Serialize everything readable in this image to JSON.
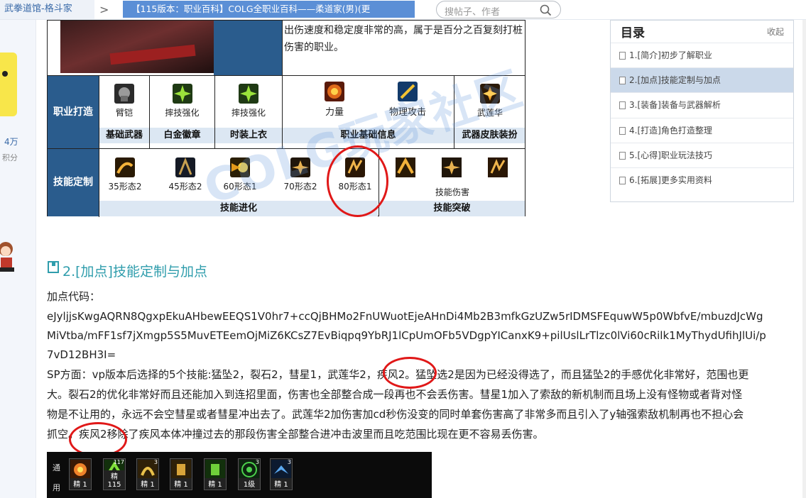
{
  "topbar": {
    "home_crumb": "武拳道馆-格斗家",
    "arrow": ">",
    "thread_crumb": "【115版本：职业百科】COLG全职业百科——柔道家(男)(更",
    "search_placeholder": "搜帖子、作者"
  },
  "leftbar": {
    "stat_value": "4万",
    "stat_label": "积分"
  },
  "profession_table": {
    "description": "出伤速度和稳定度非常的高，属于是百分之百复刻打桩伤害的职业。",
    "row1_label": "职业打造",
    "row2_label": "技能定制",
    "build_items": [
      {
        "label": "臂铠",
        "icon": "gauntlet-icon"
      },
      {
        "label": "摔技强化",
        "icon": "throw-burst-icon"
      },
      {
        "label": "摔技强化",
        "icon": "throw-burst-icon"
      },
      {
        "label": "力量",
        "icon": "strength-icon"
      },
      {
        "label": "物理攻击",
        "icon": "physical-attack-icon"
      },
      {
        "label": "武莲华",
        "icon": "lotus-skill-icon"
      }
    ],
    "build_groups": [
      "基础武器",
      "白金徽章",
      "时装上衣",
      "职业基础信息",
      "武器皮肤装扮"
    ],
    "skill_items": [
      {
        "label": "35形态2"
      },
      {
        "label": "45形态2"
      },
      {
        "label": "60形态1"
      },
      {
        "label": "70形态2"
      },
      {
        "label": "80形态1"
      },
      {
        "label": "技能伤害"
      }
    ],
    "skill_groups": [
      "技能进化",
      "技能突破"
    ],
    "watermark": "COLG玩家社区"
  },
  "toc": {
    "title": "目录",
    "collapse": "收起",
    "items": [
      "1.[简介]初步了解职业",
      "2.[加点]技能定制与加点",
      "3.[装备]装备与武器解析",
      "4.[打造]角色打造整理",
      "5.[心得]职业玩法技巧",
      "6.[拓展]更多实用资料"
    ],
    "active_index": 1
  },
  "section": {
    "title": "2.[加点]技能定制与加点",
    "code_label": "加点代码：",
    "code_lines": [
      "eJyljjsKwgAQRN8QgxpEkuAHbewEEQS1V0hr7+ccQjBHMo2FnUWuotEjeAHnDi4Mb2B3mfkGzUZw5rIDMSFEquwW5p0WbfvE/mbuzdJcWg",
      "MiVtba/mFF1sf7jXmgp5S5MuvETEemOjMiZ6KCsZ7EvBiqpq9YbRJ1lCpUmOFb5VDgpYICanxK9+pilUslLrTlzc0lVi60cRilk1MyThydUfihJlUi/p",
      "7vD12BH3I="
    ],
    "sp_lines": [
      "SP方面：vp版本后选择的5个技能:猛坠2，裂石2，彗星1，武莲华2，疾风2。猛坠选2是因为已经没得选了，而且猛坠2的手感优化非常好，范围也更",
      "大。裂石2的优化非常好而且还能加入到连招里面，伤害也全部整合成一段再也不会丢伤害。彗星1加入了索敌的新机制而且场上没有怪物或者背对怪",
      "物是不让用的，永远不会空彗星或者彗星冲出去了。武莲华2加伤害加cd秒伤没变的同时单套伤害高了非常多而且引入了y轴强索敌机制再也不担心会",
      "抓空。疾风2移除了疾风本体冲撞过去的那段伤害全部整合进冲击波里而且吃范围比现在更不容易丢伤害。"
    ]
  },
  "skillbar": {
    "label_top": "通",
    "label_bottom": "用",
    "slots": [
      {
        "cap": "精 1",
        "num": "",
        "icon": "fire-fist-icon"
      },
      {
        "cap": "精 115",
        "num": "117",
        "icon": "green-throw-icon"
      },
      {
        "cap": "精 1",
        "num": "3",
        "icon": "gold-throw-icon"
      },
      {
        "cap": "精 1",
        "num": "",
        "icon": "gold-grab-icon"
      },
      {
        "cap": "精 1",
        "num": "",
        "icon": "green-grab-icon"
      },
      {
        "cap": "1级",
        "num": "3",
        "icon": "target-icon"
      },
      {
        "cap": "精 1",
        "num": "3",
        "icon": "blue-wing-icon"
      }
    ]
  },
  "colors": {
    "table_blue": "#2a5c8d",
    "subheader_blue": "#dce7f3",
    "section_teal": "#2f9dac",
    "annotation_red": "#e01818",
    "crumb_blue": "#5b8fd6"
  }
}
